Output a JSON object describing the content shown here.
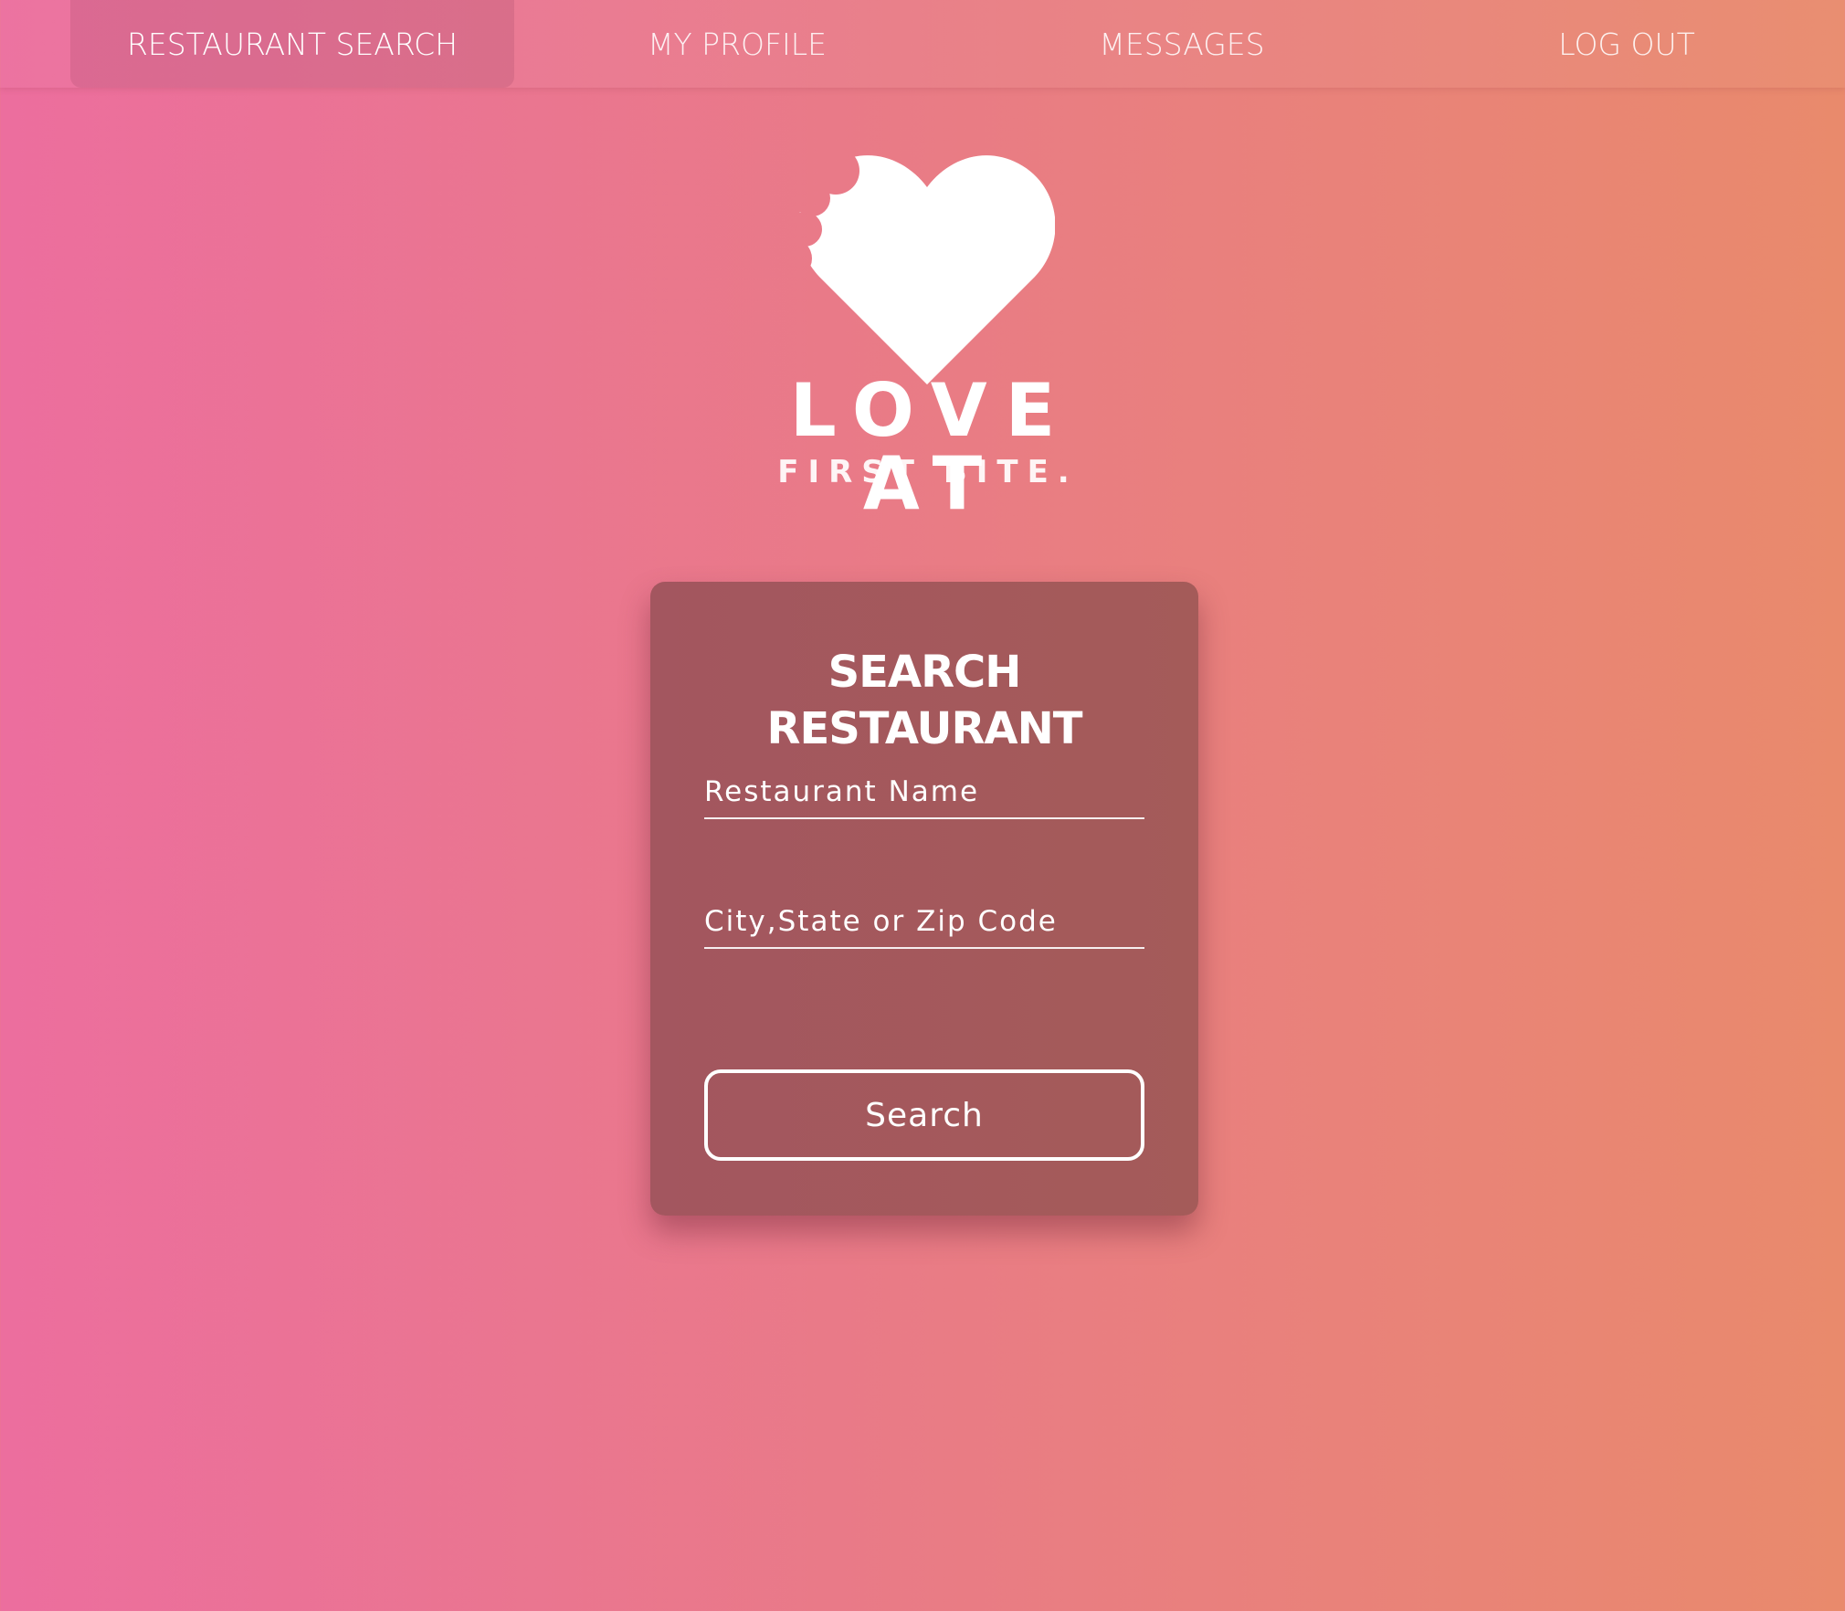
{
  "nav": {
    "items": [
      {
        "label": "RESTAURANT SEARCH",
        "active": true
      },
      {
        "label": "MY PROFILE",
        "active": false
      },
      {
        "label": "MESSAGES",
        "active": false
      },
      {
        "label": "LOG OUT",
        "active": false
      }
    ]
  },
  "logo": {
    "title": "LOVE AT",
    "subtitle": "FIRST BITE.",
    "icon": "bitten-heart-icon"
  },
  "search_card": {
    "title_line1": "SEARCH",
    "title_line2": "RESTAURANT",
    "restaurant_name": {
      "placeholder": "Restaurant Name",
      "value": ""
    },
    "location": {
      "placeholder": "City,State or Zip Code",
      "value": ""
    },
    "search_button_label": "Search"
  },
  "colors": {
    "background_gradient_start": "#ec6e9e",
    "background_gradient_end": "#e98a6c",
    "card_background": "#a3565f",
    "text": "#ffffff"
  }
}
